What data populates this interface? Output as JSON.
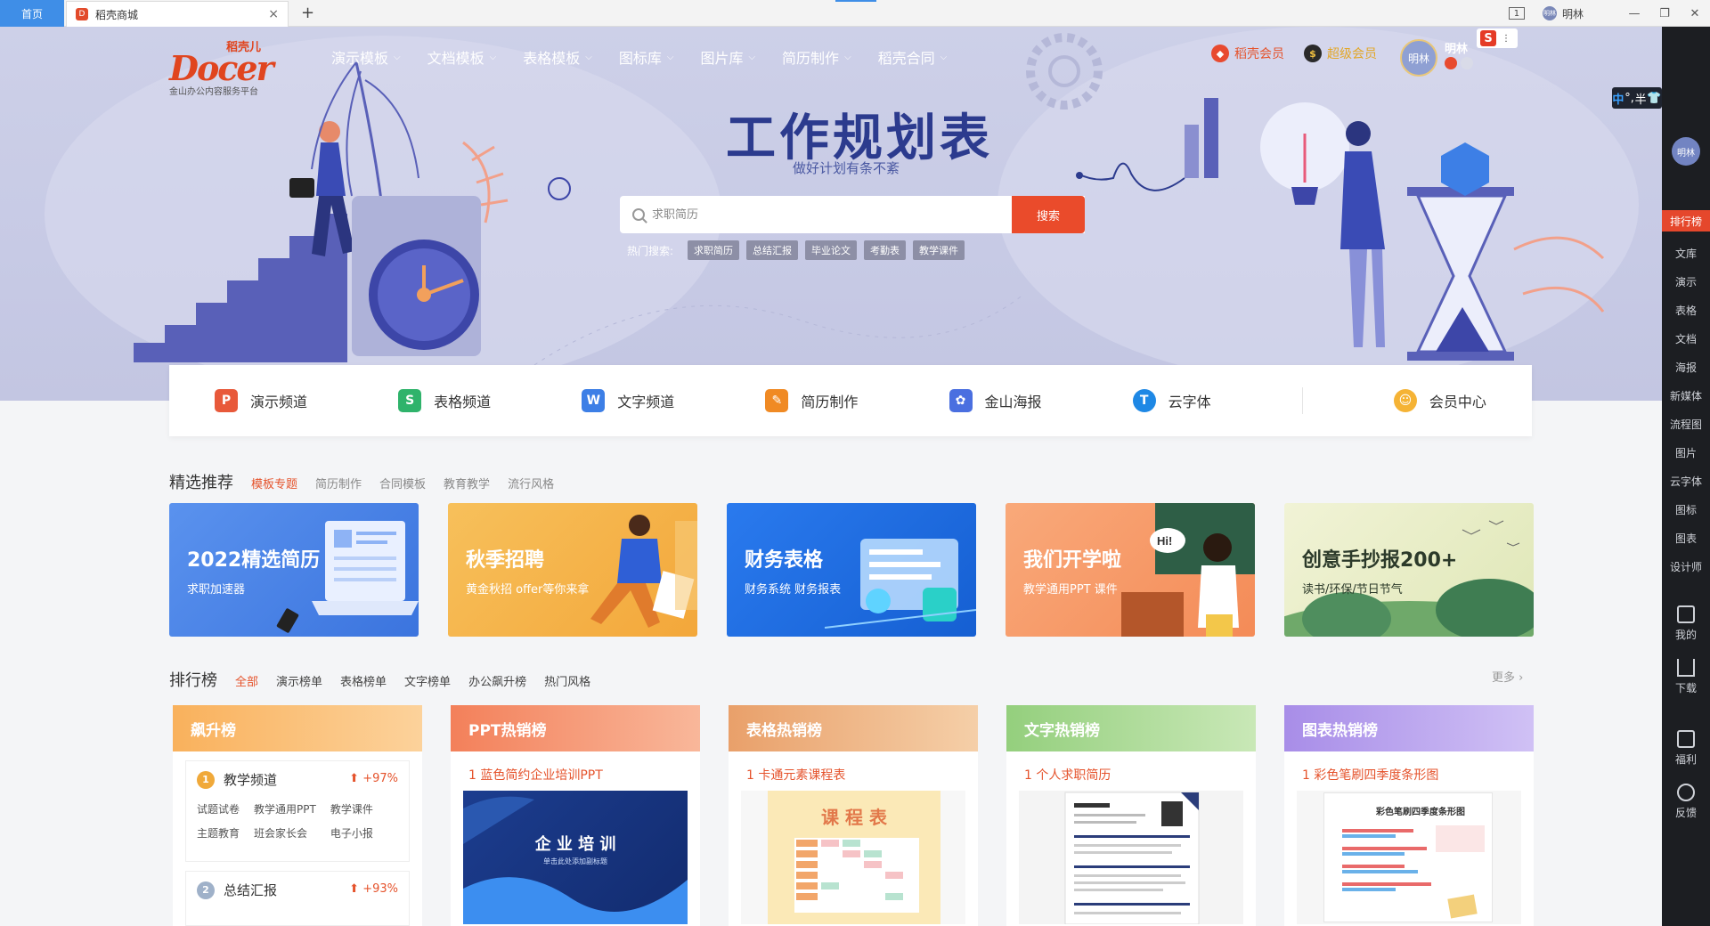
{
  "tabbar": {
    "home": "首页",
    "active_tab": "稻壳商城",
    "close": "×",
    "add": "+",
    "count_badge": "1",
    "user": "明林",
    "avatar_text": "明林"
  },
  "window": {
    "minimize": "—",
    "restore": "❐",
    "close": "✕"
  },
  "logo": {
    "top": "稻壳儿",
    "brand": "Docer",
    "slogan": "金山办公内容服务平台"
  },
  "nav": [
    {
      "label": "演示模板"
    },
    {
      "label": "文档模板"
    },
    {
      "label": "表格模板"
    },
    {
      "label": "图标库"
    },
    {
      "label": "图片库"
    },
    {
      "label": "简历制作"
    },
    {
      "label": "稻壳合同"
    }
  ],
  "header": {
    "member1": "稻壳会员",
    "member2": "超级会员",
    "avatar_text": "明林",
    "username": "明林",
    "s_badge": "S"
  },
  "ime": {
    "zh": "中",
    "comma": "°,",
    "half": "半",
    "shirt": "👕"
  },
  "hero": {
    "title": "工作规划表",
    "subtitle": "做好计划有条不紊",
    "search_placeholder": "求职简历",
    "search_button": "搜索",
    "hot_label": "热门搜索:",
    "hot_tags": [
      "求职简历",
      "总结汇报",
      "毕业论文",
      "考勤表",
      "教学课件"
    ]
  },
  "channels": [
    {
      "label": "演示频道",
      "icon": "P",
      "color": "#e8593a"
    },
    {
      "label": "表格频道",
      "icon": "S",
      "color": "#2fb36b"
    },
    {
      "label": "文字频道",
      "icon": "W",
      "color": "#3d7fe6"
    },
    {
      "label": "简历制作",
      "icon": "✎",
      "color": "#f08a24"
    },
    {
      "label": "金山海报",
      "icon": "✿",
      "color": "#4a6fe0"
    },
    {
      "label": "云字体",
      "icon": "T",
      "color": "#1e88e5"
    },
    {
      "label": "会员中心",
      "icon": "☺",
      "color": "#f5b335"
    }
  ],
  "featured": {
    "title": "精选推荐",
    "filters": [
      "模板专题",
      "简历制作",
      "合同模板",
      "教育教学",
      "流行风格"
    ],
    "cards": [
      {
        "title": "2022精选简历",
        "subtitle": "求职加速器",
        "color": "#4c86e8"
      },
      {
        "title": "秋季招聘",
        "subtitle": "黄金秋招 offer等你来拿",
        "color": "#f4b24a"
      },
      {
        "title": "财务表格",
        "subtitle": "财务系统 财务报表",
        "color": "#1f6fe0"
      },
      {
        "title": "我们开学啦",
        "subtitle": "教学通用PPT 课件",
        "color": "#f59b6a"
      },
      {
        "title": "创意手抄报200+",
        "subtitle": "读书/环保/节日节气",
        "color": "#e9ecc6"
      }
    ]
  },
  "ranking": {
    "title": "排行榜",
    "filters": [
      "全部",
      "演示榜单",
      "表格榜单",
      "文字榜单",
      "办公飙升榜",
      "热门风格"
    ],
    "more": "更多 ›",
    "columns": [
      {
        "header": "飙升榜",
        "color": "#f9b15c"
      },
      {
        "header": "PPT热销榜",
        "color": "#f3805a",
        "first": "1  蓝色简约企业培训PPT",
        "thumb_title": "企 业 培 训",
        "thumb_sub": "单击此处添加副标题"
      },
      {
        "header": "表格热销榜",
        "color": "#e9a06a",
        "first": "1  卡通元素课程表",
        "thumb_title": "课 程 表"
      },
      {
        "header": "文字热销榜",
        "color": "#94cf7d",
        "first": "1  个人求职简历"
      },
      {
        "header": "图表热销榜",
        "color": "#a88de8",
        "first": "1  彩色笔刷四季度条形图",
        "thumb_title": "彩色笔刷四季度条形图"
      }
    ],
    "soaring": [
      {
        "name": "教学频道",
        "percent": "+97%",
        "rank": "1",
        "tags": [
          "试题试卷",
          "教学通用PPT",
          "教学课件",
          "主题教育",
          "班会家长会",
          "电子小报"
        ]
      },
      {
        "name": "总结汇报",
        "percent": "+93%",
        "rank": "2"
      }
    ]
  },
  "rside": {
    "avatar": "明林",
    "top": "排行榜",
    "links": [
      "文库",
      "演示",
      "表格",
      "文档",
      "海报",
      "新媒体",
      "流程图",
      "图片",
      "云字体",
      "图标",
      "图表",
      "设计师"
    ],
    "tools": [
      "我的",
      "下载",
      "福利",
      "反馈"
    ]
  }
}
